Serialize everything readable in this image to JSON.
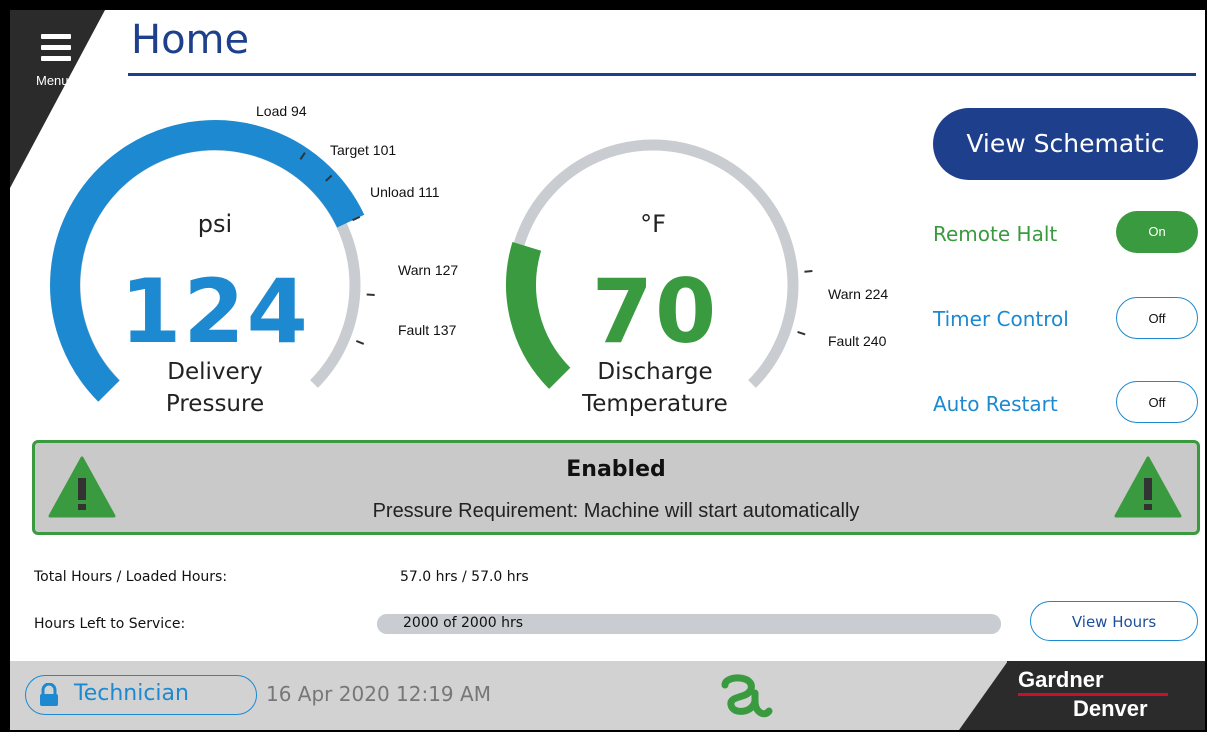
{
  "header": {
    "menu_label": "Menu",
    "title": "Home"
  },
  "gauges": {
    "pressure": {
      "unit": "psi",
      "value": "124",
      "name_line1": "Delivery",
      "name_line2": "Pressure",
      "min": 0,
      "max": 150,
      "marks": [
        {
          "label": "Load 94",
          "value": 94
        },
        {
          "label": "Target 101",
          "value": 101
        },
        {
          "label": "Unload 111",
          "value": 111
        },
        {
          "label": "Warn 127",
          "value": 127
        },
        {
          "label": "Fault 137",
          "value": 137
        }
      ],
      "color": "#1c89d0"
    },
    "temperature": {
      "unit": "°F",
      "value": "70",
      "name_line1": "Discharge",
      "name_line2": "Temperature",
      "marks": [
        {
          "label": "Warn 224"
        },
        {
          "label": "Fault 240"
        }
      ],
      "color": "#3a9a3f"
    }
  },
  "controls": {
    "view_schematic": "View Schematic",
    "remote_halt": {
      "label": "Remote Halt",
      "state": "On"
    },
    "timer_control": {
      "label": "Timer Control",
      "state": "Off"
    },
    "auto_restart": {
      "label": "Auto Restart",
      "state": "Off"
    }
  },
  "status": {
    "title": "Enabled",
    "message": "Pressure Requirement: Machine will start automatically"
  },
  "hours": {
    "total_label": "Total Hours / Loaded Hours:",
    "total_value": "57.0 hrs / 57.0 hrs",
    "service_label": "Hours Left to Service:",
    "service_value": "2000 of 2000 hrs",
    "service_fraction": 1.0,
    "view_hours": "View Hours"
  },
  "footer": {
    "user": "Technician",
    "datetime": "16 Apr 2020  12:19 AM",
    "brand_line1": "Gardner",
    "brand_line2": "Denver"
  },
  "colors": {
    "primary_blue": "#1d3f8c",
    "accent_blue": "#1c89d0",
    "green": "#3a9a3f",
    "gauge_track": "#c9ccd0"
  },
  "icons": [
    "menu-icon",
    "warning-icon",
    "lock-icon",
    "brand-swirl-icon"
  ]
}
